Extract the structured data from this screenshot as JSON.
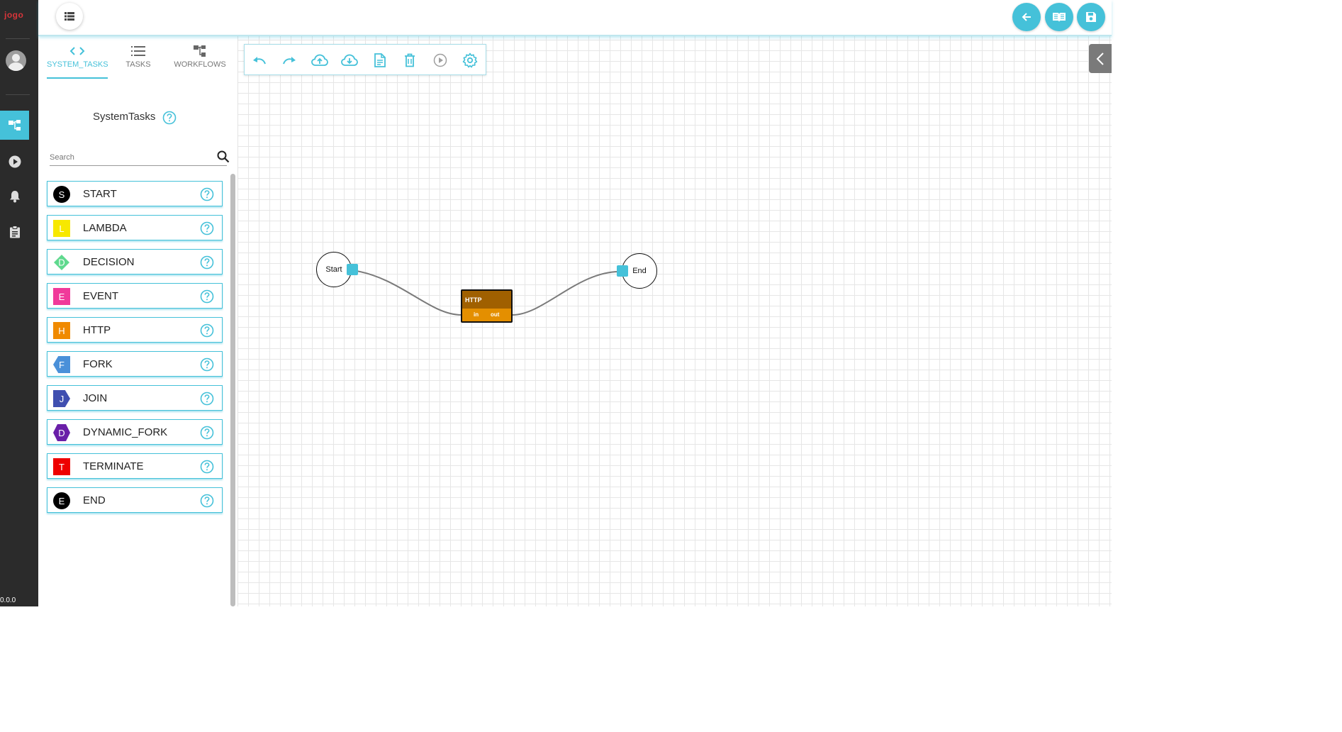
{
  "brand": "jogo",
  "version": "0.0.0",
  "panel": {
    "tabs": [
      {
        "label": "SYSTEM_TASKS",
        "icon": "code-icon"
      },
      {
        "label": "TASKS",
        "icon": "list-icon"
      },
      {
        "label": "WORKFLOWS",
        "icon": "workflow-icon"
      }
    ],
    "title": "SystemTasks",
    "search_placeholder": "Search",
    "tasks": [
      {
        "letter": "S",
        "label": "START",
        "color": "#000000",
        "shape": "circle"
      },
      {
        "letter": "L",
        "label": "LAMBDA",
        "color": "#f7e800",
        "shape": "square"
      },
      {
        "letter": "D",
        "label": "DECISION",
        "color": "#5fd98e",
        "shape": "diamond"
      },
      {
        "letter": "E",
        "label": "EVENT",
        "color": "#f03a9a",
        "shape": "square"
      },
      {
        "letter": "H",
        "label": "HTTP",
        "color": "#f08a00",
        "shape": "square"
      },
      {
        "letter": "F",
        "label": "FORK",
        "color": "#4a90d9",
        "shape": "pentagon-left"
      },
      {
        "letter": "J",
        "label": "JOIN",
        "color": "#3f4fb0",
        "shape": "pentagon-right"
      },
      {
        "letter": "D",
        "label": "DYNAMIC_FORK",
        "color": "#6a1fa8",
        "shape": "hexagon"
      },
      {
        "letter": "T",
        "label": "TERMINATE",
        "color": "#ee0000",
        "shape": "square"
      },
      {
        "letter": "E",
        "label": "END",
        "color": "#000000",
        "shape": "circle"
      }
    ]
  },
  "toolbar": {
    "tools": [
      "undo-icon",
      "redo-icon",
      "cloud-upload-icon",
      "cloud-download-icon",
      "document-icon",
      "delete-icon",
      "play-icon",
      "settings-icon"
    ]
  },
  "canvas": {
    "start_node": "Start",
    "end_node": "End",
    "http_node": {
      "name": "HTTP",
      "in": "in",
      "out": "out"
    }
  },
  "colors": {
    "accent": "#45c1d9",
    "rail": "#2b2b2b",
    "http_dark": "#a06000",
    "http_light": "#e48f00"
  }
}
